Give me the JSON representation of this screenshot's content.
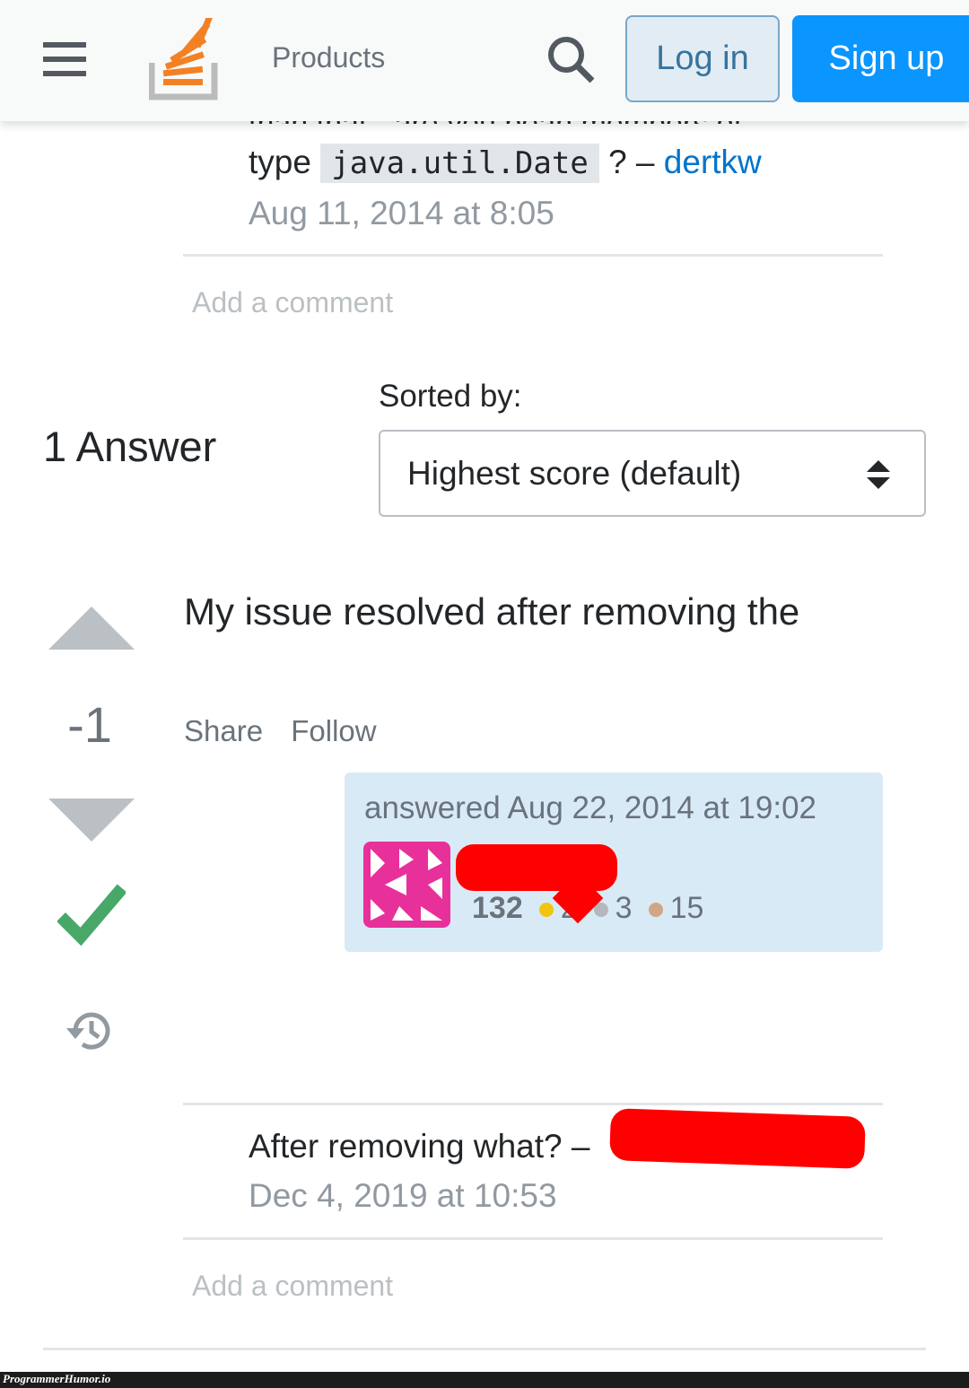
{
  "header": {
    "products": "Products",
    "login": "Log in",
    "signup": "Sign up"
  },
  "question_comment": {
    "cut_line": "than that - are you bean members of",
    "prefix": "type",
    "code": "java.util.Date",
    "suffix": "? –",
    "author": "dertkw",
    "date": "Aug 11, 2014 at 8:05"
  },
  "add_comment": "Add a comment",
  "answers": {
    "count_label": "1 Answer",
    "sorted_by": "Sorted by:",
    "sort_value": "Highest score (default)"
  },
  "answer": {
    "body": "My issue resolved after removing the",
    "score": "-1",
    "share": "Share",
    "follow": "Follow",
    "answered": "answered Aug 22, 2014 at 19:02",
    "reputation": "132",
    "gold": "2",
    "silver": "3",
    "bronze": "15",
    "accepted": true
  },
  "answer_comment": {
    "text": "After removing what? –",
    "date": "Dec 4, 2019 at 10:53"
  },
  "watermark": "ProgrammerHumor.io",
  "colors": {
    "accent": "#0a95ff",
    "accepted": "#48a868",
    "redaction": "#ff0000",
    "gold": "#f1c40f",
    "silver": "#b4b8bc",
    "bronze": "#d1a684"
  }
}
